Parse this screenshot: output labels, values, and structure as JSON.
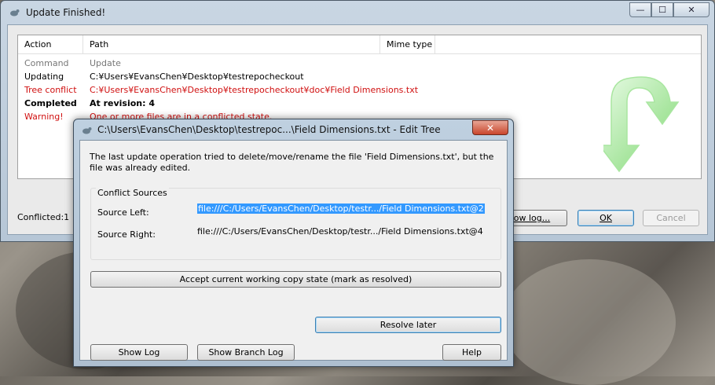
{
  "main_window": {
    "title": "Update Finished!",
    "buttons": {
      "minimize": "—",
      "maximize": "☐",
      "close": "✕"
    },
    "columns": [
      "Action",
      "Path",
      "Mime type"
    ],
    "rows": [
      {
        "action": "Command",
        "path": "Update",
        "style": "gray"
      },
      {
        "action": "Updating",
        "path": "C:¥Users¥EvansChen¥Desktop¥testrepocheckout",
        "style": "normal"
      },
      {
        "action": "Tree conflict",
        "path": "C:¥Users¥EvansChen¥Desktop¥testrepocheckout¥doc¥Field Dimensions.txt",
        "style": "red"
      },
      {
        "action": "Completed",
        "path": "At revision: 4",
        "style": "bold"
      },
      {
        "action": "Warning!",
        "path": "One or more files are in a conflicted state.",
        "style": "red"
      }
    ],
    "status": "Conflicted:1",
    "show_log_button": "Show log...",
    "ok_button": "OK",
    "cancel_button": "Cancel",
    "accent_green": "#7fd872"
  },
  "dialog": {
    "title": "C:\\Users\\EvansChen\\Desktop\\testrepoc...\\Field Dimensions.txt - Edit Tree Conflicts - Tor...",
    "close": "✕",
    "message": "The last update operation tried to delete/move/rename the file 'Field Dimensions.txt', but the file was already edited.",
    "group_title": "Conflict Sources",
    "source_left_label": "Source Left:",
    "source_left_value": "file:///C:/Users/EvansChen/Desktop/testr.../Field Dimensions.txt@2",
    "source_right_label": "Source Right:",
    "source_right_value": "file:///C:/Users/EvansChen/Desktop/testr.../Field Dimensions.txt@4",
    "accept_button": "Accept current working copy state (mark as resolved)",
    "resolve_later_button": "Resolve later",
    "show_log_button": "Show Log",
    "show_branch_log_button": "Show Branch Log",
    "help_button": "Help"
  }
}
